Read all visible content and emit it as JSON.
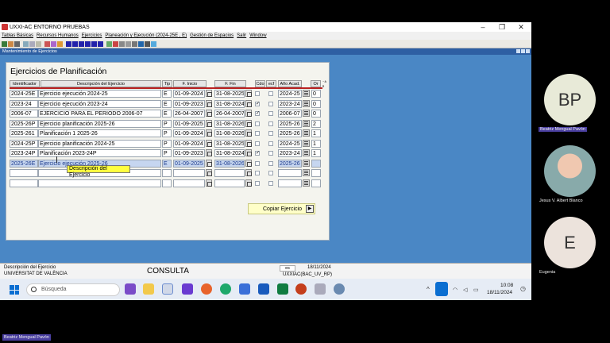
{
  "window": {
    "title": "UXXI-AC ENTORNO PRUEBAS",
    "minimize": "–",
    "maximize": "❐",
    "close": "✕"
  },
  "menu": [
    "Tablas Básicas",
    "Recursos Humanos",
    "Ejercicios",
    "Planeación y Ejecución  (2024-25E , E)",
    "Gestión de Espacios",
    "Salir",
    "Window"
  ],
  "subheader": "Mantenimiento de Ejercicios",
  "form": {
    "title": "Ejercicios de Planificación",
    "columns": {
      "identificador": "Identificador",
      "descripcion": "Descripción del Ejercicio",
      "tipo": "Tip",
      "finicio": "F. Inicio",
      "ffin": "F. Fin",
      "cdo": "Cdo",
      "ecf": "ecf",
      "anio": "Año Acad.",
      "or": "Or",
      "extra": "⁻ᴬ  ᴿ"
    },
    "rows": [
      {
        "id": "2024-25E",
        "desc": "Ejercicio ejecución 2024-25",
        "tipo": "E",
        "inicio": "01-09-2024",
        "fin": "31-08-2025",
        "cdo": false,
        "anio": "2024-25",
        "or": "0"
      },
      {
        "id": "2023-24",
        "desc": "Ejercicio ejecución 2023-24",
        "tipo": "E",
        "inicio": "01-09-2023",
        "fin": "31-08-2024",
        "cdo": true,
        "anio": "2023-24",
        "or": "0"
      },
      {
        "id": "2006-07",
        "desc": "EJERCICIO PARA EL PERIODO 2006-07",
        "tipo": "E",
        "inicio": "26-04-2007",
        "fin": "26-04-2007",
        "cdo": true,
        "anio": "2006-07",
        "or": "0"
      },
      {
        "id": "2025-26P",
        "desc": "Ejercicio planificación 2025-26",
        "tipo": "P",
        "inicio": "01-09-2025",
        "fin": "31-08-2026",
        "cdo": false,
        "anio": "2025-26",
        "or": "2"
      },
      {
        "id": "2025-261",
        "desc": "Planificación 1 2025-26",
        "tipo": "P",
        "inicio": "01-09-2024",
        "fin": "31-08-2026",
        "cdo": false,
        "anio": "2025-26",
        "or": "1"
      },
      {
        "id": "2024-25P",
        "desc": "Ejercicio planificación 2024-25",
        "tipo": "P",
        "inicio": "01-09-2024",
        "fin": "31-08-2025",
        "cdo": false,
        "anio": "2024-25",
        "or": "1"
      },
      {
        "id": "2023-24P",
        "desc": "Planificación 2023-24P",
        "tipo": "P",
        "inicio": "01-09-2023",
        "fin": "31-08-2024",
        "cdo": true,
        "anio": "2023-24",
        "or": "1"
      },
      {
        "id": "2025-26E",
        "desc": "Ejercicio ejecución 2025-26",
        "tipo": "E",
        "inicio": "01-09-2025",
        "fin": "31-08-2026",
        "cdo": false,
        "anio": "2025-26",
        "or": ""
      },
      {
        "id": "",
        "desc": "",
        "tipo": "",
        "inicio": "",
        "fin": "",
        "cdo": false,
        "anio": "",
        "or": ""
      },
      {
        "id": "",
        "desc": "",
        "tipo": "",
        "inicio": "",
        "fin": "",
        "cdo": false,
        "anio": "",
        "or": ""
      }
    ],
    "tooltip": "Descripción del Ejercicio",
    "copy_button": "Copiar Ejercicio",
    "copy_arrow": "▶"
  },
  "status": {
    "field_desc": "Descripción del Ejercicio",
    "org": "UNIVERSITAT DE VALÈNCIA",
    "mode": "CONSULTA",
    "lang": "es",
    "date": "18/11/2024",
    "user": "UXXIAC(BAC_UV_RP)"
  },
  "taskbar": {
    "search_placeholder": "Búsqueda",
    "time": "10:08",
    "date": "18/11/2024"
  },
  "participants": [
    {
      "initials": "BP",
      "name": "Beatriz Mengual Pavón"
    },
    {
      "initials": "",
      "name": "Jesus V. Albert Blanco"
    },
    {
      "initials": "E",
      "name": "Eugenia"
    }
  ],
  "speaker_label": "Beatriz Mengual Pavón"
}
